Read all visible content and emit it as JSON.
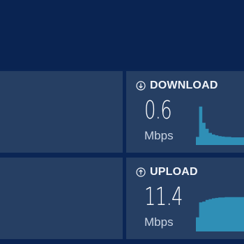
{
  "download": {
    "label": "DOWNLOAD",
    "value": "0.6",
    "unit": "Mbps",
    "icon": "arrow-down-circle-icon",
    "sparkline": [
      0.2,
      0.95,
      0.55,
      0.4,
      0.3,
      0.26,
      0.24,
      0.22,
      0.21,
      0.2,
      0.2,
      0.19,
      0.19,
      0.19,
      0.19
    ]
  },
  "upload": {
    "label": "UPLOAD",
    "value": "11.4",
    "unit": "Mbps",
    "icon": "arrow-up-circle-icon",
    "sparkline": [
      0.35,
      0.72,
      0.74,
      0.78,
      0.8,
      0.82,
      0.83,
      0.84,
      0.84,
      0.85,
      0.85,
      0.85,
      0.85,
      0.85,
      0.85
    ]
  },
  "colors": {
    "background": "#0b2655",
    "tile": "#263f63",
    "spark_fill": "#2f8fb6",
    "text": "#f2f5fa",
    "unit_text": "#c9d3e2"
  }
}
